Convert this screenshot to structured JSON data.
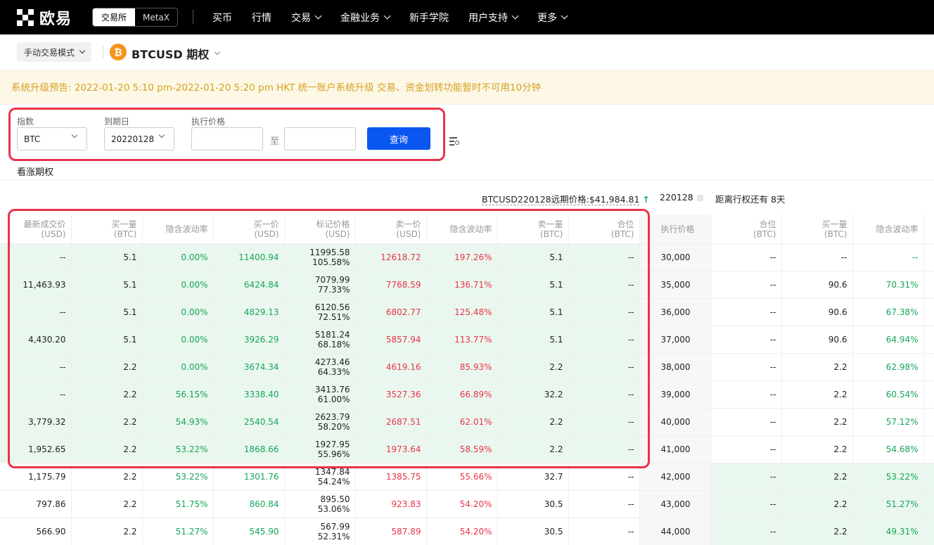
{
  "nav": {
    "logo_text": "欧易",
    "switch": [
      "交易所",
      "MetaX"
    ],
    "menu": [
      "买币",
      "行情",
      "交易",
      "金融业务",
      "新手学院",
      "用户支持",
      "更多"
    ]
  },
  "subheader": {
    "mode": "手动交易模式",
    "coin_symbol": "₿",
    "product": "BTCUSD 期权"
  },
  "notice": "系统升级预告: 2022-01-20 5:10 pm-2022-01-20 5:20 pm HKT 统一账户系统升级 交易、资金划转功能暂时不可用10分钟",
  "filters": {
    "index_label": "指数",
    "index_value": "BTC",
    "expiry_label": "到期日",
    "expiry_value": "20220128",
    "strike_label": "执行价格",
    "to": "至",
    "query": "查询"
  },
  "call_title": "看涨期权",
  "info": {
    "forward": "BTCUSD220128远期价格:$41,984.81",
    "expiry": "220128",
    "days": "距离行权还有 8天"
  },
  "columns": {
    "call": [
      "最新成交价\n(USD)",
      "买一量\n(BTC)",
      "隐含波动率",
      "买一价\n(USD)",
      "标记价格\n(USD)",
      "卖一价\n(USD)",
      "隐含波动率",
      "卖一量\n(BTC)",
      "合位\n(BTC)"
    ],
    "strike": "执行价格",
    "put": [
      "合位\n(BTC)",
      "买一量\n(BTC)",
      "隐含波动率"
    ]
  },
  "rows": [
    {
      "last": "--",
      "bid_size": "5.1",
      "bid_iv": "0.00%",
      "bid": "11400.94",
      "mark": "11995.58",
      "mark_iv": "105.58%",
      "ask": "12618.72",
      "ask_iv": "197.26%",
      "ask_size": "5.1",
      "pos": "--",
      "strike": "30,000",
      "p_pos": "--",
      "p_bid_size": "--",
      "p_bid_iv": "--"
    },
    {
      "last": "11,463.93",
      "bid_size": "5.1",
      "bid_iv": "0.00%",
      "bid": "6424.84",
      "mark": "7079.99",
      "mark_iv": "77.33%",
      "ask": "7768.59",
      "ask_iv": "136.71%",
      "ask_size": "5.1",
      "pos": "--",
      "strike": "35,000",
      "p_pos": "--",
      "p_bid_size": "90.6",
      "p_bid_iv": "70.31%"
    },
    {
      "last": "--",
      "bid_size": "5.1",
      "bid_iv": "0.00%",
      "bid": "4829.13",
      "mark": "6120.56",
      "mark_iv": "72.51%",
      "ask": "6802.77",
      "ask_iv": "125.48%",
      "ask_size": "5.1",
      "pos": "--",
      "strike": "36,000",
      "p_pos": "--",
      "p_bid_size": "90.6",
      "p_bid_iv": "67.38%"
    },
    {
      "last": "4,430.20",
      "bid_size": "5.1",
      "bid_iv": "0.00%",
      "bid": "3926.29",
      "mark": "5181.24",
      "mark_iv": "68.18%",
      "ask": "5857.94",
      "ask_iv": "113.77%",
      "ask_size": "5.1",
      "pos": "--",
      "strike": "37,000",
      "p_pos": "--",
      "p_bid_size": "90.6",
      "p_bid_iv": "64.94%"
    },
    {
      "last": "--",
      "bid_size": "2.2",
      "bid_iv": "0.00%",
      "bid": "3674.34",
      "mark": "4273.46",
      "mark_iv": "64.33%",
      "ask": "4619.16",
      "ask_iv": "85.93%",
      "ask_size": "2.2",
      "pos": "--",
      "strike": "38,000",
      "p_pos": "--",
      "p_bid_size": "2.2",
      "p_bid_iv": "62.98%"
    },
    {
      "last": "--",
      "bid_size": "2.2",
      "bid_iv": "56.15%",
      "bid": "3338.40",
      "mark": "3413.76",
      "mark_iv": "61.00%",
      "ask": "3527.36",
      "ask_iv": "66.89%",
      "ask_size": "32.2",
      "pos": "--",
      "strike": "39,000",
      "p_pos": "--",
      "p_bid_size": "2.2",
      "p_bid_iv": "60.54%"
    },
    {
      "last": "3,779.32",
      "bid_size": "2.2",
      "bid_iv": "54.93%",
      "bid": "2540.54",
      "mark": "2623.79",
      "mark_iv": "58.20%",
      "ask": "2687.51",
      "ask_iv": "62.01%",
      "ask_size": "2.2",
      "pos": "--",
      "strike": "40,000",
      "p_pos": "--",
      "p_bid_size": "2.2",
      "p_bid_iv": "57.12%"
    },
    {
      "last": "1,952.65",
      "bid_size": "2.2",
      "bid_iv": "53.22%",
      "bid": "1868.66",
      "mark": "1927.95",
      "mark_iv": "55.96%",
      "ask": "1973.64",
      "ask_iv": "58.59%",
      "ask_size": "2.2",
      "pos": "--",
      "strike": "41,000",
      "p_pos": "--",
      "p_bid_size": "2.2",
      "p_bid_iv": "54.68%"
    },
    {
      "last": "1,175.79",
      "bid_size": "2.2",
      "bid_iv": "53.22%",
      "bid": "1301.76",
      "mark": "1347.84",
      "mark_iv": "54.24%",
      "ask": "1385.75",
      "ask_iv": "55.66%",
      "ask_size": "32.7",
      "pos": "--",
      "strike": "42,000",
      "p_pos": "--",
      "p_bid_size": "2.2",
      "p_bid_iv": "53.22%"
    },
    {
      "last": "797.86",
      "bid_size": "2.2",
      "bid_iv": "51.75%",
      "bid": "860.84",
      "mark": "895.50",
      "mark_iv": "53.06%",
      "ask": "923.83",
      "ask_iv": "54.20%",
      "ask_size": "30.5",
      "pos": "--",
      "strike": "43,000",
      "p_pos": "--",
      "p_bid_size": "2.2",
      "p_bid_iv": "51.27%"
    },
    {
      "last": "566.90",
      "bid_size": "2.2",
      "bid_iv": "51.27%",
      "bid": "545.90",
      "mark": "567.99",
      "mark_iv": "52.31%",
      "ask": "587.89",
      "ask_iv": "54.20%",
      "ask_size": "30.5",
      "pos": "--",
      "strike": "44,000",
      "p_pos": "--",
      "p_bid_size": "2.2",
      "p_bid_iv": "49.31%"
    }
  ]
}
